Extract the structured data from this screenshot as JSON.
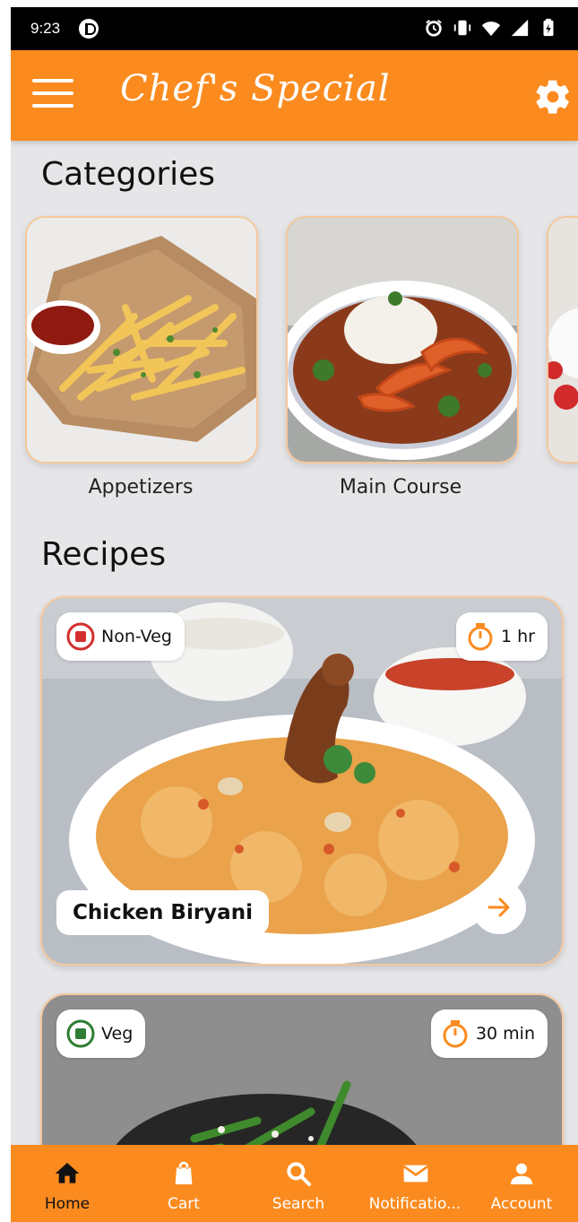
{
  "status_bar": {
    "time": "9:23"
  },
  "app_bar": {
    "title": "Chef's Special"
  },
  "categories": {
    "title": "Categories",
    "items": [
      {
        "label": "Appetizers"
      },
      {
        "label": "Main Course"
      }
    ]
  },
  "recipes": {
    "title": "Recipes",
    "items": [
      {
        "type": "Non-Veg",
        "time": "1 hr",
        "name": "Chicken Biryani"
      },
      {
        "type": "Veg",
        "time": "30 min"
      }
    ]
  },
  "bottom_nav": {
    "items": [
      {
        "label": "Home",
        "icon": "home-icon",
        "active": true
      },
      {
        "label": "Cart",
        "icon": "shopping-bag-icon"
      },
      {
        "label": "Search",
        "icon": "search-icon"
      },
      {
        "label": "Notificatio...",
        "icon": "mail-icon"
      },
      {
        "label": "Account",
        "icon": "account-icon"
      }
    ]
  },
  "colors": {
    "accent": "#fb8b1f",
    "background": "#e6e6e9",
    "card_border": "#f5c79c",
    "non_veg": "#d32f2f",
    "veg": "#2e7d32"
  }
}
